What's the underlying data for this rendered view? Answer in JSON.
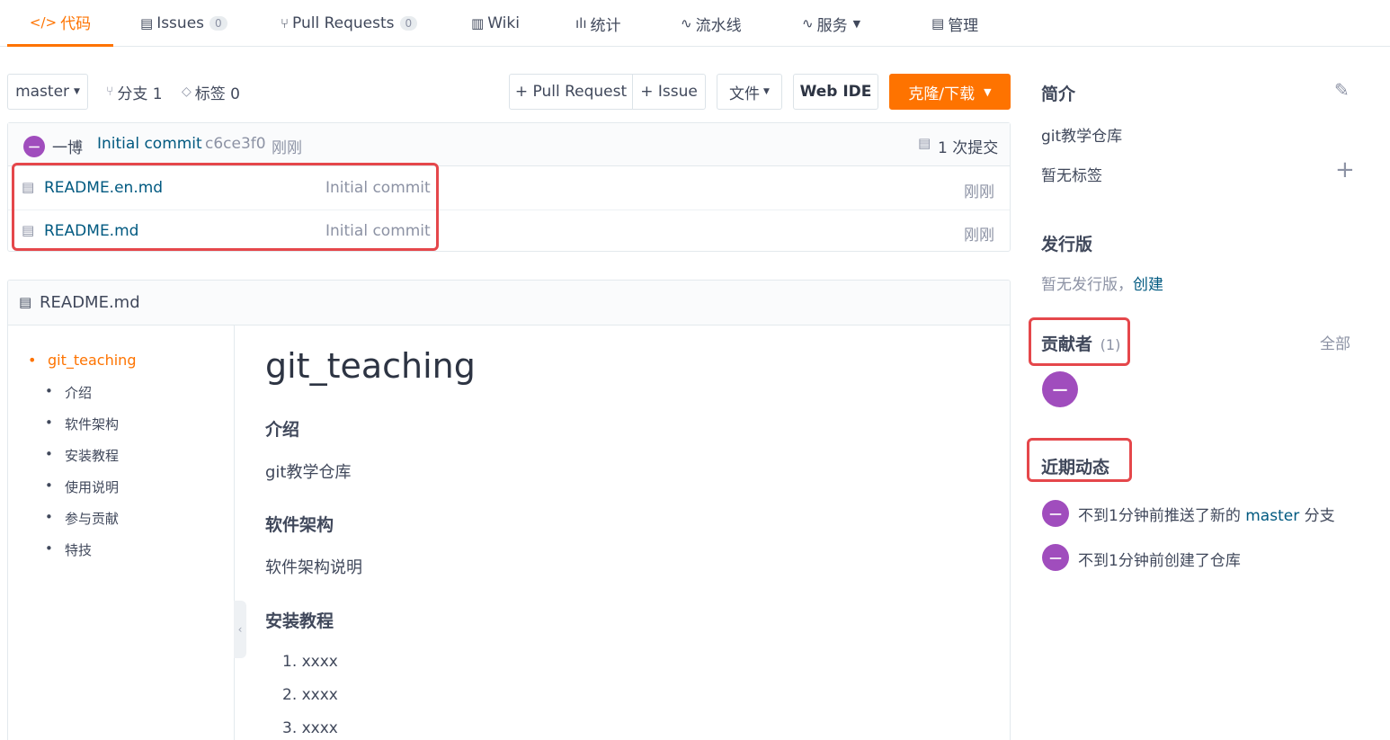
{
  "nav": {
    "tabs": [
      {
        "icon": "</>",
        "label": "代码",
        "count": null
      },
      {
        "icon": "▤",
        "label": "Issues",
        "count": "0"
      },
      {
        "icon": "⑂",
        "label": "Pull Requests",
        "count": "0"
      },
      {
        "icon": "▥",
        "label": "Wiki",
        "count": null
      },
      {
        "icon": "ılı",
        "label": "统计",
        "count": null
      },
      {
        "icon": "∿",
        "label": "流水线",
        "count": null
      },
      {
        "icon": "∿",
        "label": "服务",
        "count": null
      },
      {
        "icon": "▤",
        "label": "管理",
        "count": null
      }
    ]
  },
  "toolbar": {
    "branch": "master",
    "branches_label": "分支 1",
    "tags_label": "标签 0",
    "pull_request_label": "+ Pull Request",
    "issue_label": "+ Issue",
    "file_label": "文件",
    "web_ide_label": "Web IDE",
    "clone_label": "克隆/下载"
  },
  "commit": {
    "avatar_initial": "一",
    "author": "一博",
    "message": "Initial commit",
    "hash": "c6ce3f0",
    "time": "刚刚",
    "commits_count": "1 次提交"
  },
  "files": [
    {
      "name": "README.en.md",
      "message": "Initial commit",
      "time": "刚刚"
    },
    {
      "name": "README.md",
      "message": "Initial commit",
      "time": "刚刚"
    }
  ],
  "readme": {
    "filename": "README.md",
    "toc": [
      "git_teaching",
      "介绍",
      "软件架构",
      "安装教程",
      "使用说明",
      "参与贡献",
      "特技"
    ],
    "title": "git_teaching",
    "sections": {
      "intro_heading": "介绍",
      "intro_text": "git教学仓库",
      "arch_heading": "软件架构",
      "arch_text": "软件架构说明",
      "install_heading": "安装教程",
      "install_steps": [
        "1. xxxx",
        "2. xxxx",
        "3. xxxx"
      ]
    }
  },
  "sidebar": {
    "intro_title": "简介",
    "description": "git教学仓库",
    "no_tags": "暂无标签",
    "releases_title": "发行版",
    "no_releases": "暂无发行版，",
    "create_link": "创建",
    "contributors_title": "贡献者",
    "contributors_count": "(1)",
    "all_link": "全部",
    "activity_title": "近期动态",
    "activities": [
      {
        "prefix": "不到1分钟前推送了新的",
        "link": "master",
        "suffix": "分支"
      },
      {
        "prefix": "不到1分钟前创建了仓库",
        "link": "",
        "suffix": ""
      }
    ]
  },
  "colors": {
    "accent": "#fe7300",
    "link": "#005980",
    "avatar": "#a04dbd",
    "highlight": "#e5474b"
  }
}
